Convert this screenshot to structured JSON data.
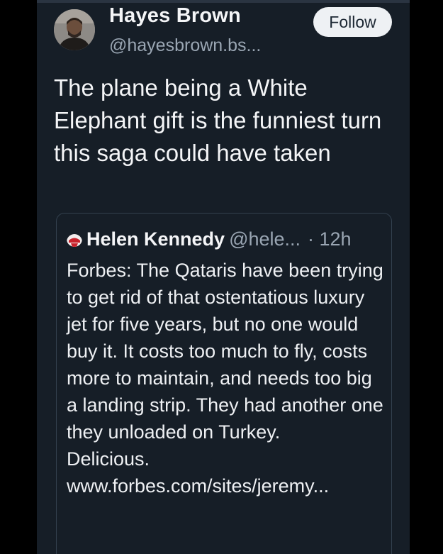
{
  "post": {
    "author": {
      "display_name": "Hayes Brown",
      "handle": "@hayesbrown.bs..."
    },
    "follow_label": "Follow",
    "text": "The plane being a White Elephant gift is the funniest turn this saga could have taken",
    "quote": {
      "author": "Helen Kennedy",
      "handle": "@hele...",
      "time": "· 12h",
      "text": "Forbes: The Qataris have been trying to get rid of that ostentatious luxury jet for five years, but no one would buy it. It costs too much to fly, costs more to maintain, and needs too big a landing strip. They had another one they unloaded on Turkey.",
      "text2": "Delicious.",
      "link": "www.forbes.com/sites/jeremy..."
    }
  },
  "colors": {
    "page_background": "#000000",
    "panel_background": "#161e27",
    "primary_text": "#f4f5f7",
    "secondary_text": "#9aa6b3",
    "follow_button_background": "#eef1f4",
    "card_border": "#33404e"
  }
}
